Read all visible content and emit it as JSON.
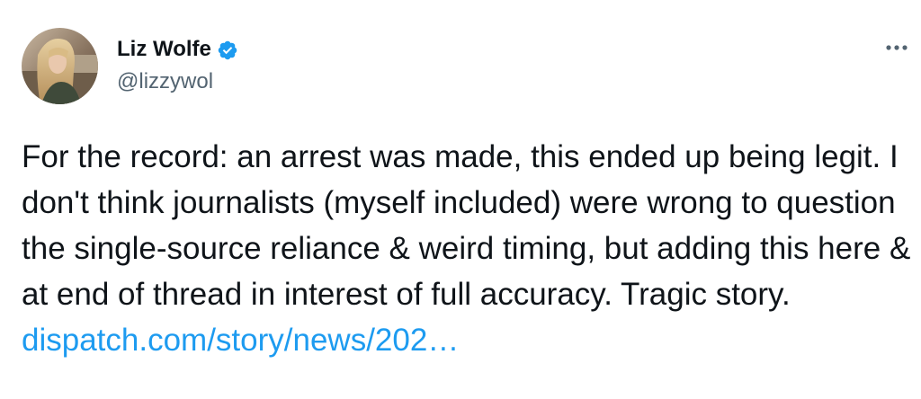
{
  "tweet": {
    "author": {
      "display_name": "Liz Wolfe",
      "handle": "@lizzywol",
      "verified": true,
      "avatar_icon": "profile-photo"
    },
    "more_icon": "more-horizontal-icon",
    "text": "For the record: an arrest was made, this ended up being legit. I don't think journalists (myself included) were wrong to question the single-source reliance & weird timing, but adding this here & at end of thread in interest of full accuracy. Tragic story.",
    "link_text": "dispatch.com/story/news/202…"
  },
  "colors": {
    "verified_badge": "#1d9bf0",
    "link": "#1d9bf0",
    "handle": "#536471",
    "text": "#0f1419"
  }
}
